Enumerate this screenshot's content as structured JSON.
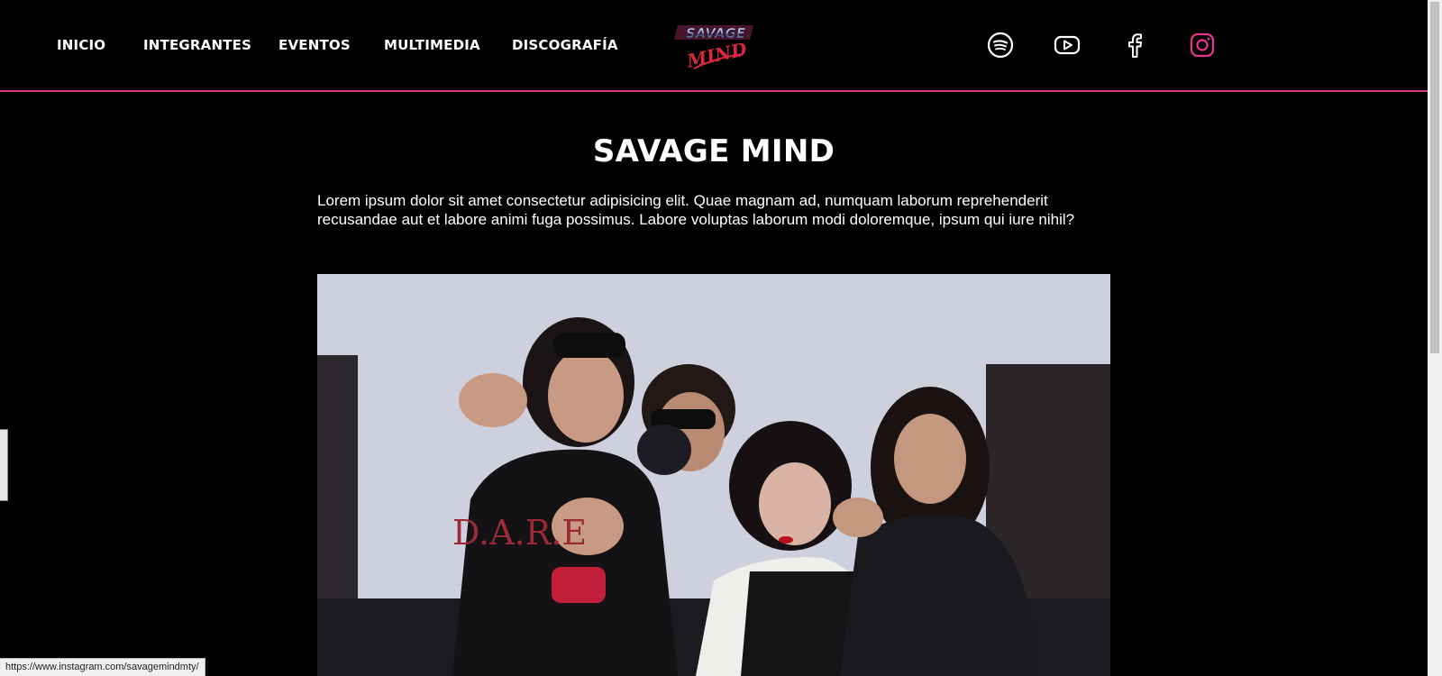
{
  "nav": {
    "links": [
      "INICIO",
      "INTEGRANTES",
      "EVENTOS",
      "MULTIMEDIA",
      "DISCOGRAFÍA"
    ]
  },
  "logo": {
    "line1": "SAVAGE",
    "line2": "MIND",
    "colors": {
      "chrome": "#cfd6ff",
      "accent": "#d63a80"
    }
  },
  "social": [
    {
      "icon": "spotify-icon"
    },
    {
      "icon": "youtube-icon"
    },
    {
      "icon": "facebook-icon"
    },
    {
      "icon": "instagram-icon",
      "color": "#e8368f"
    }
  ],
  "main": {
    "title": "SAVAGE MIND",
    "intro": "Lorem ipsum dolor sit amet consectetur adipisicing elit. Quae magnam ad, numquam laborum reprehenderit recusandae aut et labore animi fuga possimus. Labore voluptas laborum modi doloremque, ipsum qui iure nihil?"
  },
  "status_bar": {
    "url": "https://www.instagram.com/savagemindmty/"
  },
  "colors": {
    "accent": "#d63a80",
    "background": "#000000",
    "text": "#ffffff"
  }
}
